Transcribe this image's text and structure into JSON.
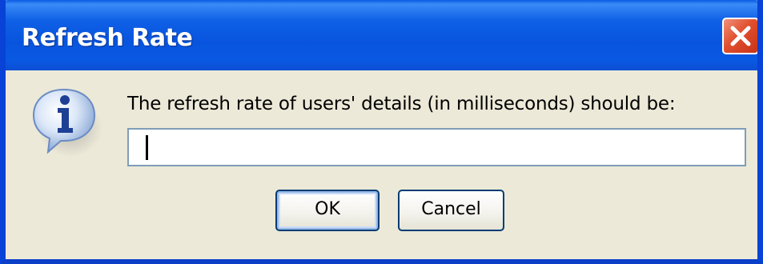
{
  "dialog": {
    "title": "Refresh Rate",
    "close_icon": "close-icon",
    "message_icon": "info-icon",
    "prompt": "The refresh rate of users' details (in milliseconds) should be:",
    "input": {
      "value": "",
      "placeholder": ""
    },
    "buttons": {
      "ok_label": "OK",
      "cancel_label": "Cancel"
    }
  },
  "colors": {
    "titlebar": "#0a59e2",
    "close_button": "#e0502e",
    "window_background": "#ece9d8",
    "input_border": "#7f9db9",
    "button_border": "#003c74"
  }
}
